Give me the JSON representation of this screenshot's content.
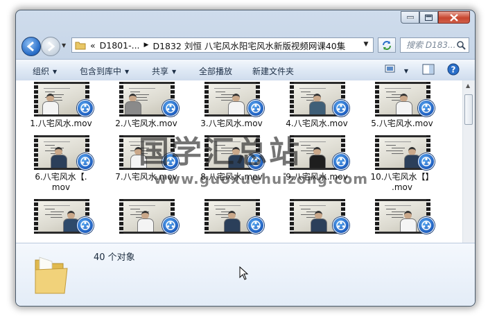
{
  "address": {
    "chevrons": "«",
    "crumbs": [
      "D1801-...",
      "D1832 刘恒 八宅风水阳宅风水新版视频网课40集"
    ]
  },
  "search": {
    "placeholder": "搜索 D183..."
  },
  "toolbar": {
    "organize": "组织",
    "include_in_library": "包含到库中",
    "share": "共享",
    "play_all": "全部播放",
    "new_folder": "新建文件夹"
  },
  "files": [
    {
      "label": "1.八宅风水.mov"
    },
    {
      "label": "2.八宅风水.mov"
    },
    {
      "label": "3.八宅风水.mov"
    },
    {
      "label": "4.八宅风水.mov"
    },
    {
      "label": "5.八宅风水.mov"
    },
    {
      "label": "6.八宅风水【.\nmov"
    },
    {
      "label": "7.八宅风水.mov"
    },
    {
      "label": "8.八宅风水.mov"
    },
    {
      "label": "9.八宅风水.mov"
    },
    {
      "label": "10.八宅风水【】\n.mov"
    },
    {
      "label": ""
    },
    {
      "label": ""
    },
    {
      "label": ""
    },
    {
      "label": ""
    },
    {
      "label": ""
    }
  ],
  "watermark": {
    "text": "国学汇总站",
    "url": "www.guoxuehuizong.com"
  },
  "details": {
    "count": "40 个对象"
  },
  "colors": {
    "accent": "#1f5fc0",
    "toolbar_text": "#1d2f46",
    "close": "#c7462f"
  },
  "icons": [
    "back-arrow-icon",
    "forward-arrow-icon",
    "folder-icon",
    "refresh-icon",
    "search-icon",
    "view-icon",
    "preview-pane-icon",
    "help-icon",
    "video-badge-icon",
    "minimize-icon",
    "maximize-icon",
    "close-icon"
  ]
}
